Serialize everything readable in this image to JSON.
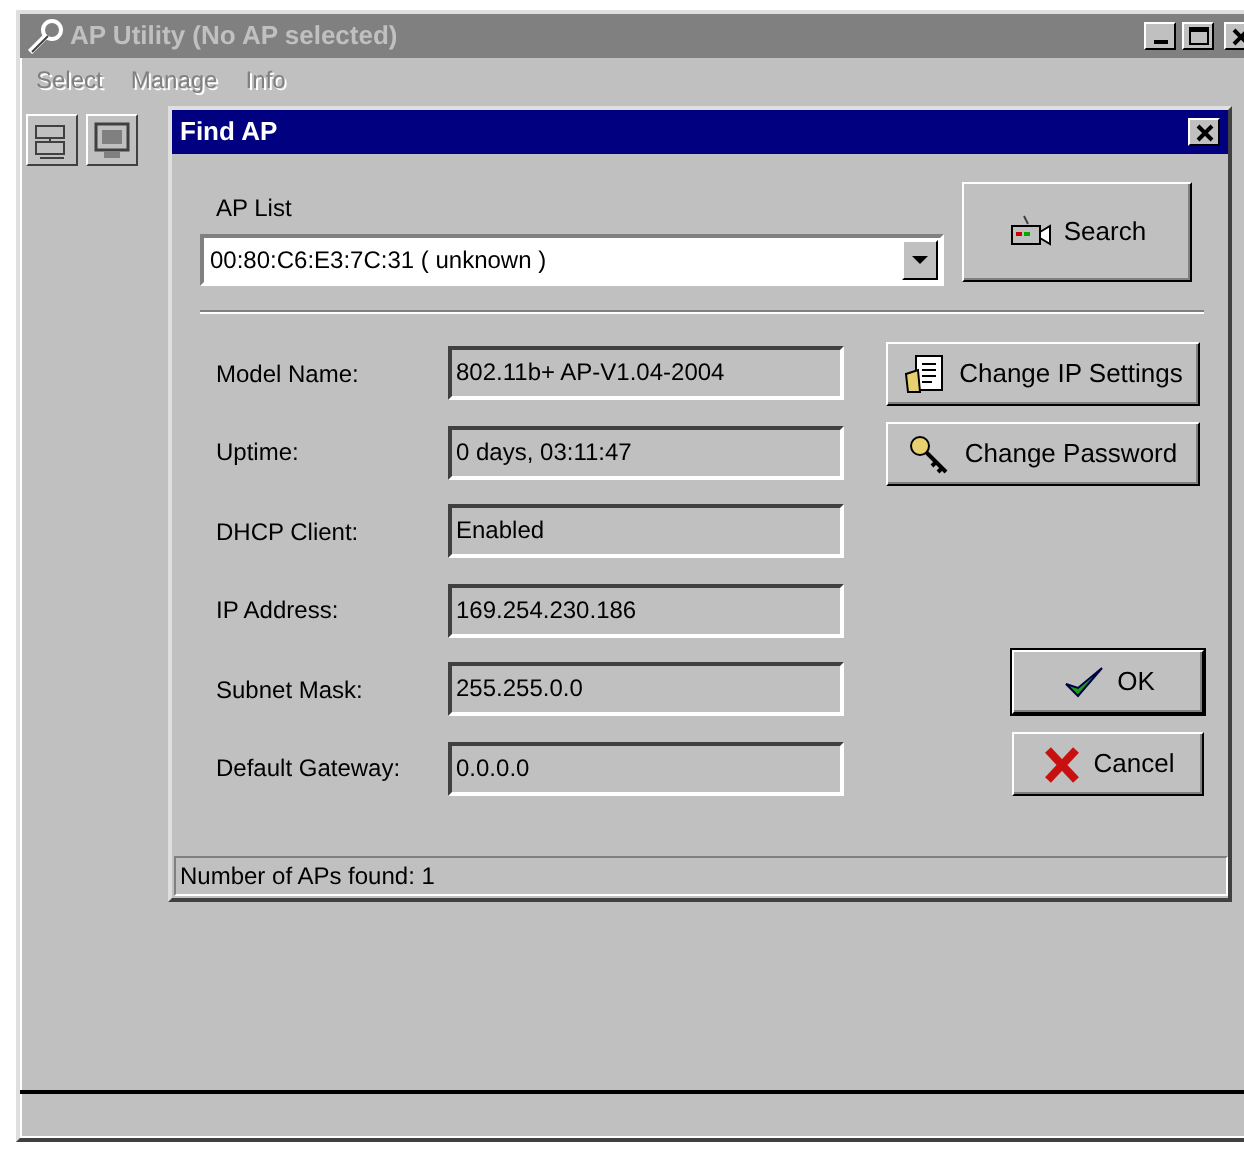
{
  "window": {
    "title": "AP Utility (No AP selected)",
    "active": false
  },
  "menu": [
    {
      "label": "Select",
      "disabled": true
    },
    {
      "label": "Manage",
      "disabled": true
    },
    {
      "label": "Info",
      "disabled": true
    }
  ],
  "toolbar": [
    {
      "kind": "network"
    },
    {
      "kind": "monitor"
    }
  ],
  "dialog": {
    "title": "Find AP",
    "active": true,
    "ap_list": {
      "label": "AP List",
      "value": "00:80:C6:E3:7C:31 ( unknown )"
    },
    "search_button": {
      "label": "Search"
    },
    "fields": [
      {
        "label": "Model Name:",
        "value": "802.11b+ AP-V1.04-2004"
      },
      {
        "label": "Uptime:",
        "value": "0 days, 03:11:47"
      },
      {
        "label": "DHCP Client:",
        "value": "Enabled"
      },
      {
        "label": "IP Address:",
        "value": "169.254.230.186"
      },
      {
        "label": "Subnet Mask:",
        "value": "255.255.0.0"
      },
      {
        "label": "Default Gateway:",
        "value": "0.0.0.0"
      }
    ],
    "buttons": [
      {
        "kind": "ip",
        "label": "Change IP Settings"
      },
      {
        "kind": "key",
        "label": "Change Password"
      },
      {
        "kind": "ok",
        "label": "OK",
        "default": true
      },
      {
        "kind": "cancel",
        "label": "Cancel",
        "default": false
      }
    ],
    "status": "Number of APs found: 1"
  }
}
